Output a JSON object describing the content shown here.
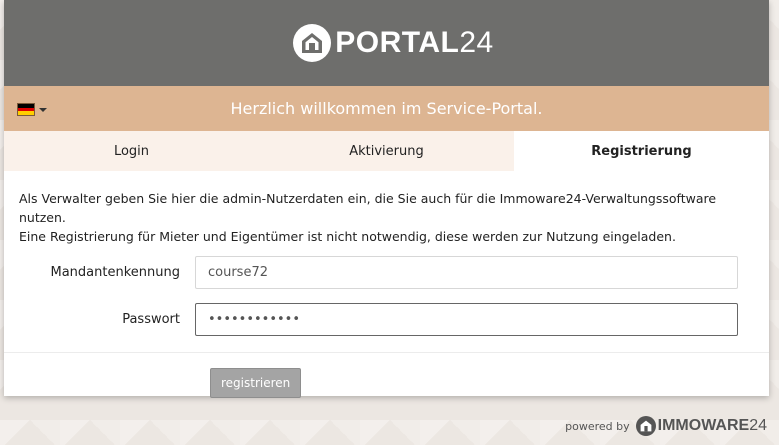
{
  "header": {
    "logo_main": "PORTAL",
    "logo_suffix": "24",
    "logo_icon": "house-icon"
  },
  "welcome": {
    "text": "Herzlich willkommen im Service-Portal.",
    "language_flag": "germany-flag-icon",
    "flag_colors": [
      "#000000",
      "#dd0000",
      "#ffce00"
    ]
  },
  "tabs": [
    {
      "label": "Login",
      "active": false
    },
    {
      "label": "Aktivierung",
      "active": false
    },
    {
      "label": "Registrierung",
      "active": true
    }
  ],
  "form": {
    "intro_line1": "Als Verwalter geben Sie hier die admin-Nutzerdaten ein, die Sie auch für die Immoware24-Verwaltungssoftware nutzen.",
    "intro_line2": "Eine Registrierung für Mieter und Eigentümer ist nicht notwendig, diese werden zur Nutzung eingeladen.",
    "client_id_label": "Mandantenkennung",
    "client_id_value": "course72",
    "password_label": "Passwort",
    "password_value": "••••••••••••",
    "submit_label": "registrieren"
  },
  "footer": {
    "powered_by": "powered by",
    "brand_main": "IMMOWARE",
    "brand_suffix": "24"
  },
  "colors": {
    "header_bg": "#6e6e6c",
    "welcome_bg": "#ddb592",
    "tab_inactive_bg": "#faf1ea",
    "button_bg": "#a4a4a4"
  }
}
